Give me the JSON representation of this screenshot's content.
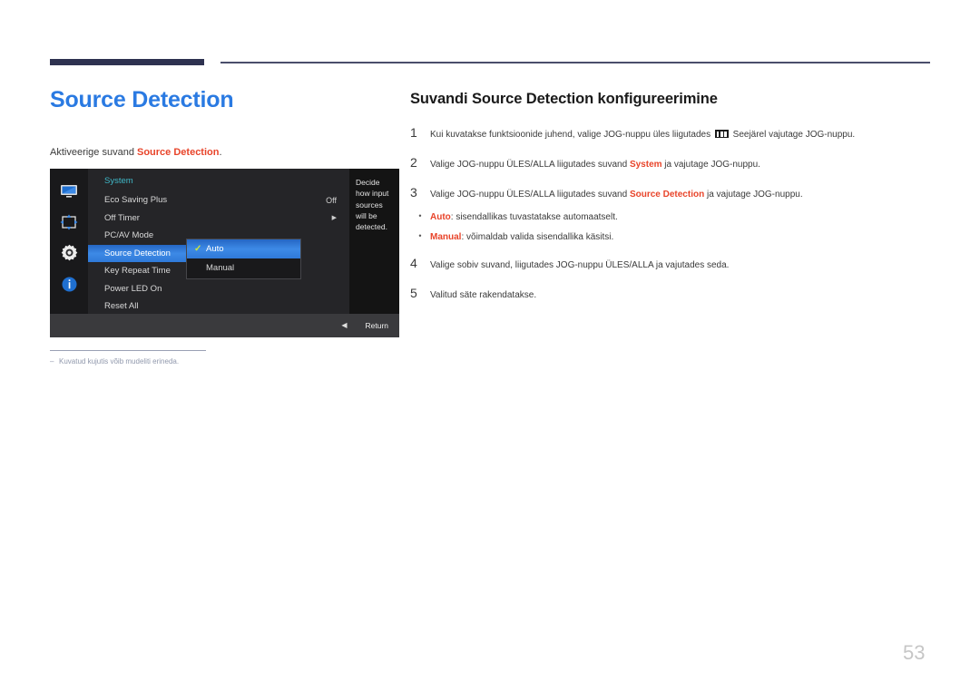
{
  "page_title": "Source Detection",
  "intro": {
    "prefix": "Aktiveerige suvand ",
    "accent": "Source Detection",
    "suffix": "."
  },
  "osd": {
    "sidebar_icons": [
      "monitor-icon",
      "resize-icon",
      "gear-icon",
      "info-icon"
    ],
    "section_label": "System",
    "menu_items": [
      {
        "label": "Eco Saving Plus",
        "value": "Off",
        "arrow": "",
        "selected": false
      },
      {
        "label": "Off Timer",
        "value": "",
        "arrow": "▶",
        "selected": false
      },
      {
        "label": "PC/AV Mode",
        "value": "",
        "arrow": "",
        "selected": false
      },
      {
        "label": "Source Detection",
        "value": "",
        "arrow": "",
        "selected": true
      },
      {
        "label": "Key Repeat Time",
        "value": "",
        "arrow": "",
        "selected": false
      },
      {
        "label": "Power LED On",
        "value": "",
        "arrow": "",
        "selected": false
      },
      {
        "label": "Reset All",
        "value": "",
        "arrow": "",
        "selected": false
      }
    ],
    "description": "Decide how input sources will be detected.",
    "submenu": [
      {
        "label": "Auto",
        "checked": true,
        "selected": true
      },
      {
        "label": "Manual",
        "checked": false,
        "selected": false
      }
    ],
    "check_glyph": "✓",
    "bottom_bar": {
      "back_arrow": "◀",
      "return_label": "Return"
    },
    "colors": {
      "highlight": "#3d8ae6",
      "section_text": "#3fb8c8",
      "check": "#cde83a"
    }
  },
  "footnote": {
    "dash": "–",
    "text": "Kuvatud kujutis võib mudeliti erineda."
  },
  "right": {
    "title": "Suvandi Source Detection konfigureerimine",
    "steps": [
      {
        "num": "1",
        "parts": [
          {
            "t": "text",
            "v": "Kui kuvatakse funktsioonide juhend, valige JOG-nuppu üles liigutades "
          },
          {
            "t": "keyglyph"
          },
          {
            "t": "text",
            "v": " Seejärel vajutage JOG-nuppu."
          }
        ]
      },
      {
        "num": "2",
        "parts": [
          {
            "t": "text",
            "v": "Valige JOG-nuppu ÜLES/ALLA liigutades suvand "
          },
          {
            "t": "accent",
            "v": "System"
          },
          {
            "t": "text",
            "v": " ja vajutage JOG-nuppu."
          }
        ]
      },
      {
        "num": "3",
        "parts": [
          {
            "t": "text",
            "v": "Valige JOG-nuppu ÜLES/ALLA liigutades suvand "
          },
          {
            "t": "accent",
            "v": "Source Detection"
          },
          {
            "t": "text",
            "v": " ja vajutage JOG-nuppu."
          }
        ]
      }
    ],
    "bullets": [
      {
        "dot": "•",
        "parts": [
          {
            "t": "accent",
            "v": "Auto"
          },
          {
            "t": "text",
            "v": ": sisendallikas tuvastatakse automaatselt."
          }
        ]
      },
      {
        "dot": "•",
        "parts": [
          {
            "t": "accent",
            "v": "Manual"
          },
          {
            "t": "text",
            "v": ": võimaldab valida sisendallika käsitsi."
          }
        ]
      }
    ],
    "steps_after": [
      {
        "num": "4",
        "parts": [
          {
            "t": "text",
            "v": "Valige sobiv suvand, liigutades JOG-nuppu ÜLES/ALLA ja vajutades seda."
          }
        ]
      },
      {
        "num": "5",
        "parts": [
          {
            "t": "text",
            "v": "Valitud säte rakendatakse."
          }
        ]
      }
    ]
  },
  "page_number": "53"
}
